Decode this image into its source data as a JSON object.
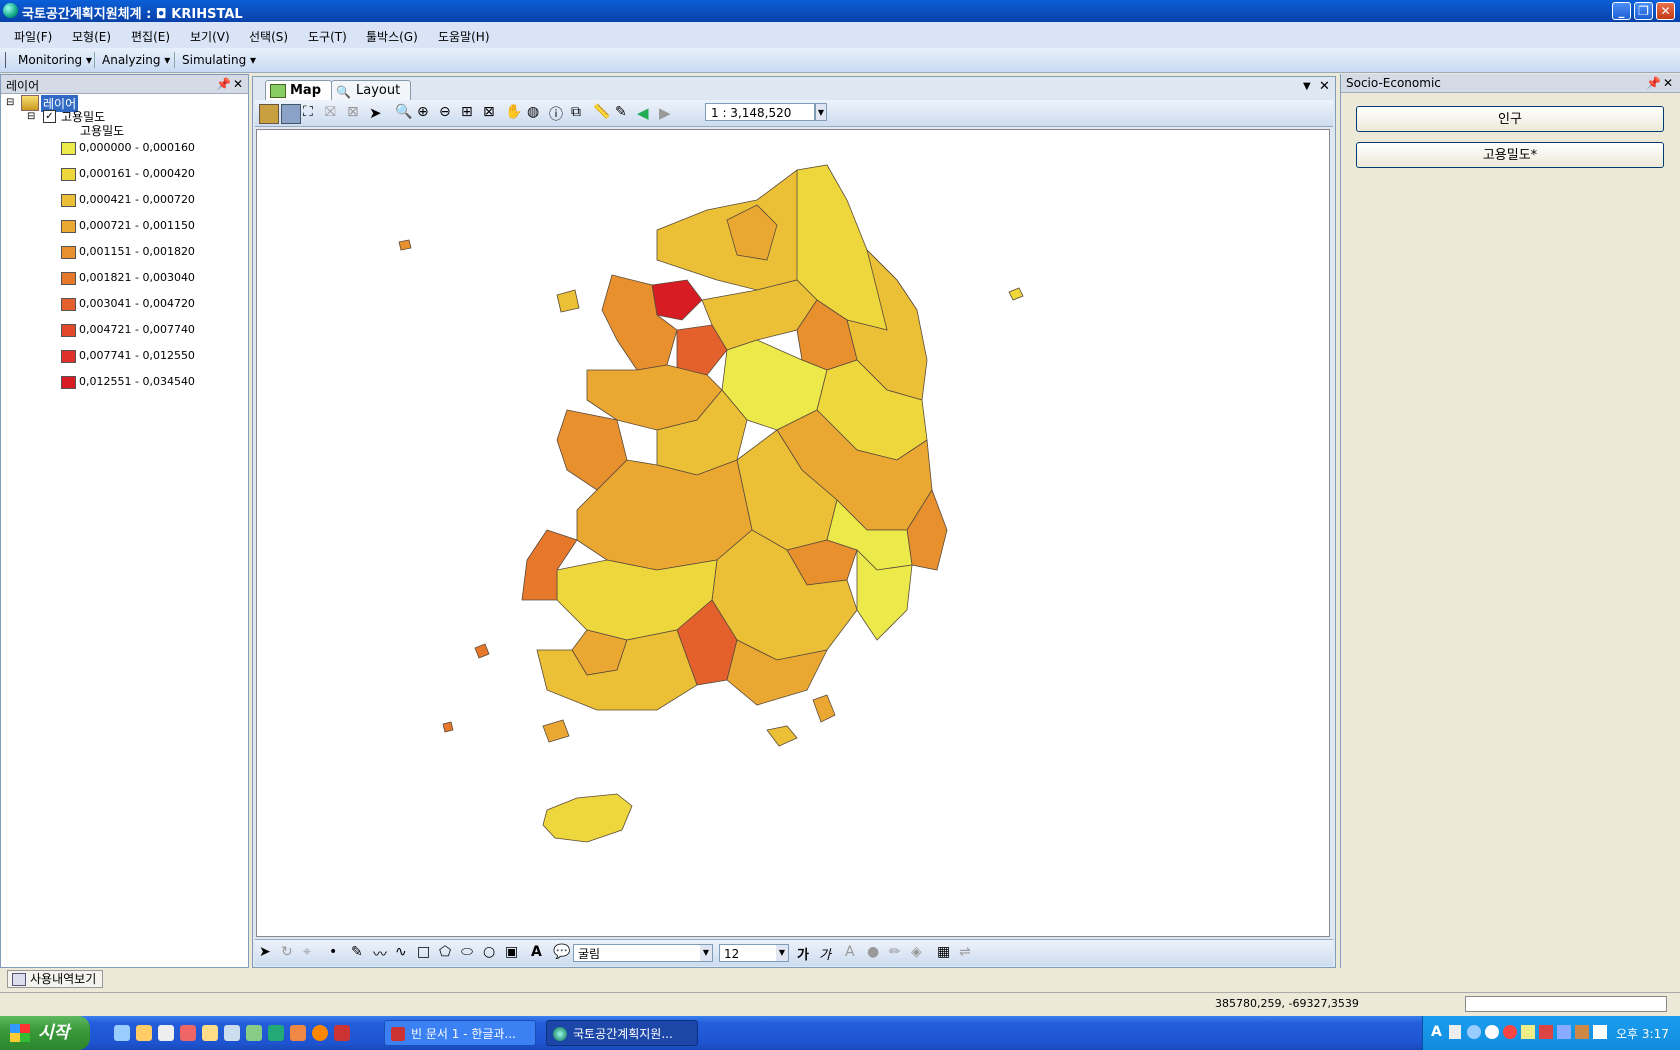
{
  "window": {
    "title": "국토공간계획지원체계 : ◘ KRIHSTAL"
  },
  "menu": [
    "파일(F)",
    "모형(E)",
    "편집(E)",
    "보기(V)",
    "선택(S)",
    "도구(T)",
    "툴박스(G)",
    "도움말(H)"
  ],
  "toolbar": {
    "monitoring": "Monitoring ▾",
    "analyzing": "Analyzing ▾",
    "simulating": "Simulating ▾"
  },
  "layers_panel": {
    "title": "레이어",
    "root": "레이어",
    "layer": "고용밀도",
    "field": "고용밀도",
    "legend": [
      {
        "label": "0,000000 - 0,000160",
        "color": "#ecea4a"
      },
      {
        "label": "0,000161 - 0,000420",
        "color": "#eed73c"
      },
      {
        "label": "0,000421 - 0,000720",
        "color": "#ecc036"
      },
      {
        "label": "0,000721 - 0,001150",
        "color": "#eaa832"
      },
      {
        "label": "0,001151 - 0,001820",
        "color": "#e8902e"
      },
      {
        "label": "0,001821 - 0,003040",
        "color": "#e6782c"
      },
      {
        "label": "0,003041 - 0,004720",
        "color": "#e4602c"
      },
      {
        "label": "0,004721 - 0,007740",
        "color": "#e2482c"
      },
      {
        "label": "0,007741 - 0,012550",
        "color": "#e0302c"
      },
      {
        "label": "0,012551 - 0,034540",
        "color": "#d81c24"
      }
    ],
    "bottom_tab": "사용내역보기"
  },
  "map_window": {
    "tabs": [
      "Map",
      "Layout"
    ],
    "scale": "1 : 3,148,520",
    "font_name": "굴림",
    "font_size": "12"
  },
  "right_panel": {
    "title": "Socio-Economic",
    "buttons": [
      "인구",
      "고용밀도*"
    ]
  },
  "status": {
    "coords": "385780,259, -69327,3539"
  },
  "taskbar": {
    "start": "시작",
    "tasks": [
      "빈 문서 1 - 한글과...",
      "국토공간계획지원..."
    ],
    "clock": "오후 3:17"
  }
}
